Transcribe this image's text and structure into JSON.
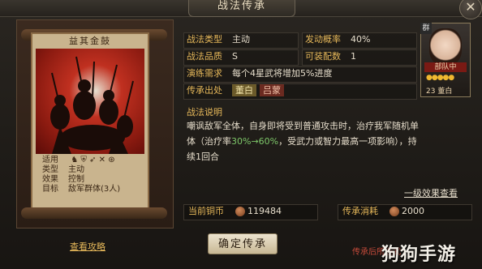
{
  "window": {
    "title": "战法传承",
    "close_icon": "close-icon"
  },
  "card": {
    "title": "益其金鼓",
    "attributes": [
      {
        "key": "适用",
        "value": ""
      },
      {
        "key": "类型",
        "value": "主动"
      },
      {
        "key": "效果",
        "value": "控制"
      },
      {
        "key": "目标",
        "value": "敌军群体(3人)"
      }
    ],
    "troop_icons": [
      "cavalry-icon",
      "shield-icon",
      "bow-icon",
      "spear-icon",
      "siege-icon"
    ]
  },
  "info": {
    "type_label": "战法类型",
    "type_value": "主动",
    "quality_label": "战法品质",
    "quality_value": "S",
    "rate_label": "发动概率",
    "rate_value": "40%",
    "equip_label": "可装配数",
    "equip_value": "1",
    "demand_label": "演练需求",
    "demand_value": "每个4星武将增加5%进度",
    "source_label": "传承出处",
    "source_names": [
      "董白",
      "吕蒙"
    ]
  },
  "description": {
    "title": "战法说明",
    "line1": "嘲讽敌军全体，自身即将受到普通攻击时，治疗我军随机单",
    "line2_pre": "体（治疗率",
    "line2_green": "30%→60%",
    "line2_post": "，受武力或智力最高一项影响），持",
    "line3": "续1回合"
  },
  "level_link": "一级效果查看",
  "costs": {
    "copper_label": "当前铜币",
    "copper_value": "119484",
    "consume_label": "传承消耗",
    "consume_value": "2000"
  },
  "footer": {
    "guide_link": "查看攻略",
    "confirm_button": "确定传承",
    "hint": "传承后所选武",
    "watermark": "狗狗手游"
  },
  "hero": {
    "badge": "群",
    "tag": "部队中",
    "stars": "●●●●●",
    "level": "23 董白"
  }
}
